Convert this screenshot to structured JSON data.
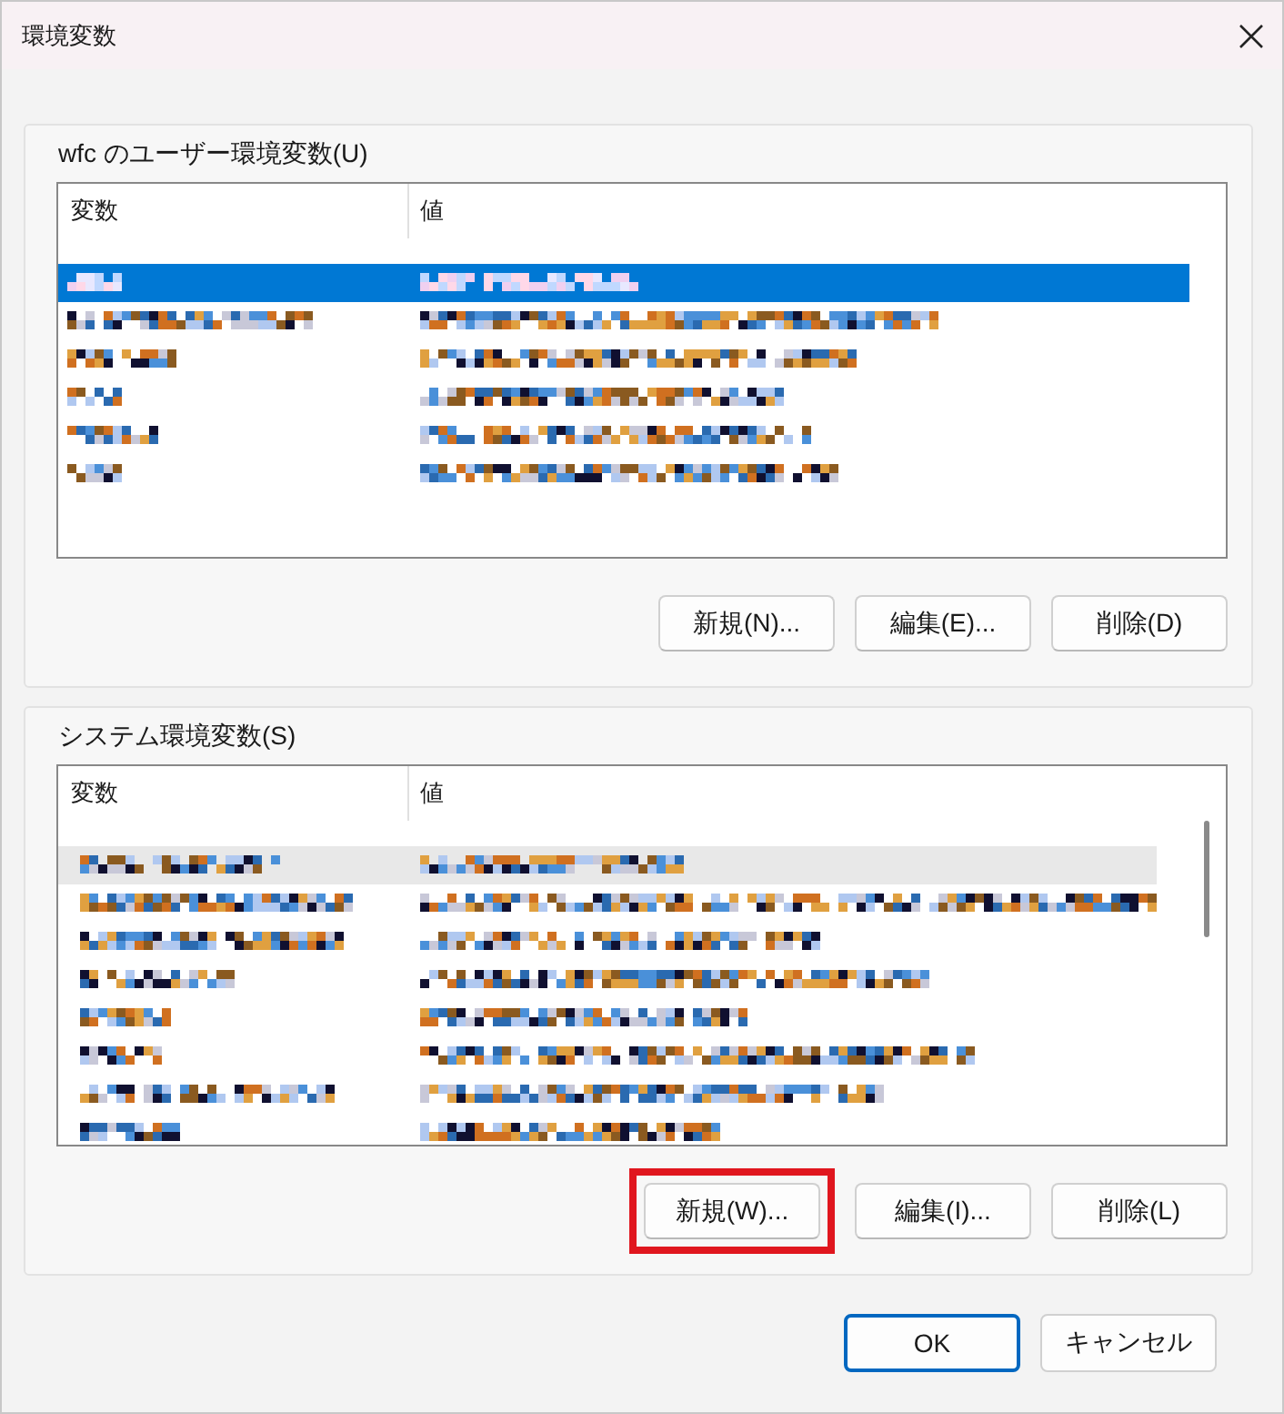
{
  "window": {
    "title": "環境変数"
  },
  "groups": [
    {
      "label": "wfc のユーザー環境変数(U)",
      "list": {
        "focused": true,
        "scrollbar": false,
        "columns": [
          "変数",
          "値"
        ],
        "rows": [
          {
            "selected": true
          },
          {
            "selected": false
          },
          {
            "selected": false
          },
          {
            "selected": false
          },
          {
            "selected": false
          },
          {
            "selected": false
          }
        ]
      },
      "buttons": [
        {
          "label": "新規(N)...",
          "highlighted": false
        },
        {
          "label": "編集(E)...",
          "highlighted": false
        },
        {
          "label": "削除(D)",
          "highlighted": false
        }
      ]
    },
    {
      "label": "システム環境変数(S)",
      "list": {
        "focused": false,
        "scrollbar": true,
        "columns": [
          "変数",
          "値"
        ],
        "rows": [
          {
            "selected": true
          },
          {
            "selected": false
          },
          {
            "selected": false
          },
          {
            "selected": false
          },
          {
            "selected": false
          },
          {
            "selected": false
          },
          {
            "selected": false
          },
          {
            "selected": false
          }
        ]
      },
      "buttons": [
        {
          "label": "新規(W)...",
          "highlighted": true
        },
        {
          "label": "編集(I)...",
          "highlighted": false
        },
        {
          "label": "削除(L)",
          "highlighted": false
        }
      ]
    }
  ],
  "footer": [
    {
      "label": "OK",
      "default": true
    },
    {
      "label": "キャンセル",
      "default": false
    }
  ]
}
